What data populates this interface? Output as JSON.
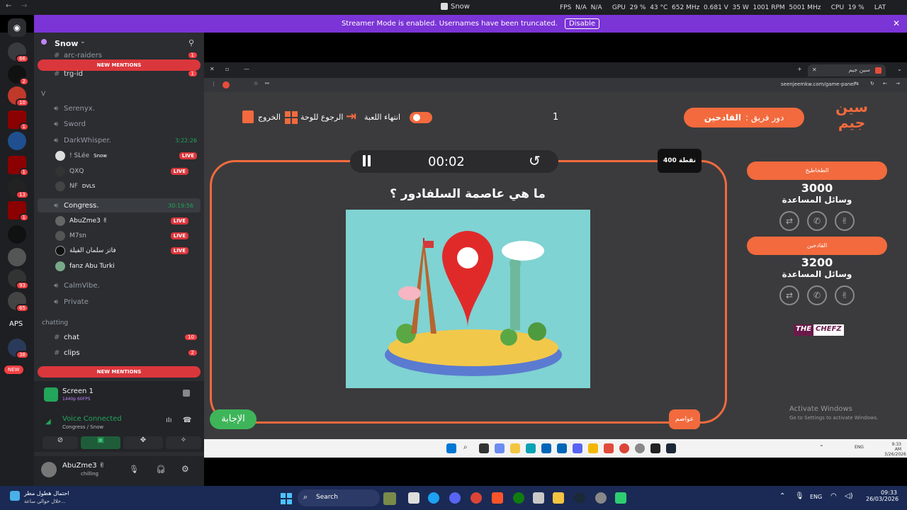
{
  "topbar": {
    "title": "Snow",
    "stats": "FPS  N/A  N/A     GPU  29 %  43 °C  652 MHz  0.681 V  35 W  1001 RPM  5001 MHz     CPU  19 %     LAT  N/A  N/A"
  },
  "banner": {
    "text": "Streamer Mode is enabled. Usernames have been truncated.",
    "disable": "Disable"
  },
  "servers": {
    "badges": [
      "66",
      "2",
      "10",
      "1",
      "1",
      "1",
      "13",
      "1",
      "93",
      "65",
      "6",
      "38",
      "1"
    ],
    "aps": "APS",
    "new": "NEW"
  },
  "channels": {
    "server_name": "Snow",
    "new_mentions": "NEW MENTIONS",
    "items": [
      {
        "name": "arc-raiders",
        "count": "1"
      },
      {
        "name": "trg-id",
        "count": "1"
      }
    ],
    "category_v": "V",
    "voice": [
      "Serenyx.",
      "Sword",
      "DarkWhisper.",
      "Congress.",
      "CalmVibe.",
      "Private"
    ],
    "darkwhisper_time": "3:22:26",
    "congress_time": "30:19:56",
    "dw_users": [
      {
        "name": "! SLée",
        "tag": "Snow",
        "live": "LIVE"
      },
      {
        "name": "QXQ",
        "live": "LIVE"
      },
      {
        "name": "NF",
        "tag": "DVLS"
      }
    ],
    "cg_users": [
      {
        "name": "AbuZme3 ✌",
        "live": "LIVE"
      },
      {
        "name": "M7sn",
        "live": "LIVE"
      },
      {
        "name": "فاتز سلمان الفيلة",
        "live": "LIVE"
      },
      {
        "name": "fanz Abu Turki"
      }
    ],
    "category_chat": "chatting",
    "chat_items": [
      {
        "name": "chat",
        "count": "10"
      },
      {
        "name": "clips",
        "count": "2"
      }
    ]
  },
  "screen": {
    "title": "Screen 1",
    "quality": "1440p 60FPS"
  },
  "voice": {
    "status": "Voice Connected",
    "where": "Congress / Snow"
  },
  "user": {
    "name": "AbuZme3 ✌",
    "status": "chilling"
  },
  "browser": {
    "tab": "سين جيم",
    "url": "seenjeemkw.com/game-panel"
  },
  "game": {
    "exit": "الخروج",
    "back": "الرجوع للوحة",
    "end": "انتهاء اللعبة",
    "round": "1",
    "turn_label": "دور فريق :",
    "turn_team": "القادحين",
    "timer": "00:02",
    "points": "400 نقطة",
    "question": "ما هي عاصمة السلفادور ؟",
    "answer": "الإجابة",
    "category": "عواصم",
    "logo_line1": "سين",
    "logo_line2": "جيم",
    "teams": [
      {
        "name": "الطخاطيخ",
        "score": "3000",
        "helpers": "وسائل المساعدة"
      },
      {
        "name": "القادحين",
        "score": "3200",
        "helpers": "وسائل المساعدة"
      }
    ],
    "sponsor_a": "THE",
    "sponsor_b": "CHEFZ",
    "activate_title": "Activate Windows",
    "activate_sub": "Go to Settings to activate Windows."
  },
  "inner_taskbar": {
    "lang": "ENG",
    "time": "9:33 AM",
    "date": "3/26/2026"
  },
  "windows_taskbar": {
    "search": "Search",
    "lang": "ENG",
    "time": "09:33",
    "date": "26/03/2026",
    "weather_title": "احتمال هطول مطر",
    "weather_sub": "خلال حوالي ساعة..."
  },
  "colors": {
    "accent": "#f26a3d",
    "discord_bg": "#2b2d31",
    "game_bg": "#3b3b3d",
    "streamer_banner": "#7b34d6",
    "live": "#da373c"
  }
}
